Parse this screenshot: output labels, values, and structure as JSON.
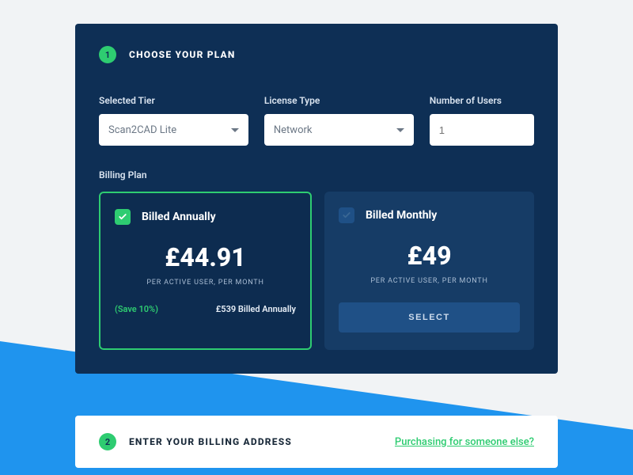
{
  "step1": {
    "number": "1",
    "title": "CHOOSE YOUR PLAN",
    "tier": {
      "label": "Selected Tier",
      "value": "Scan2CAD Lite"
    },
    "license": {
      "label": "License Type",
      "value": "Network"
    },
    "users": {
      "label": "Number of Users",
      "placeholder": "1"
    },
    "billing_label": "Billing Plan",
    "plans": {
      "annual": {
        "title": "Billed Annually",
        "price": "£44.91",
        "sub": "PER ACTIVE USER, PER MONTH",
        "save": "(Save 10%)",
        "total": "£539 Billed Annually"
      },
      "monthly": {
        "title": "Billed Monthly",
        "price": "£49",
        "sub": "PER ACTIVE USER, PER MONTH",
        "select_label": "SELECT"
      }
    }
  },
  "step2": {
    "number": "2",
    "title": "ENTER YOUR BILLING ADDRESS",
    "alt_link": "Purchasing for someone else?"
  },
  "colors": {
    "accent": "#2ecc71",
    "panel": "#0e2f55",
    "bg_accent": "#1f94ee"
  }
}
